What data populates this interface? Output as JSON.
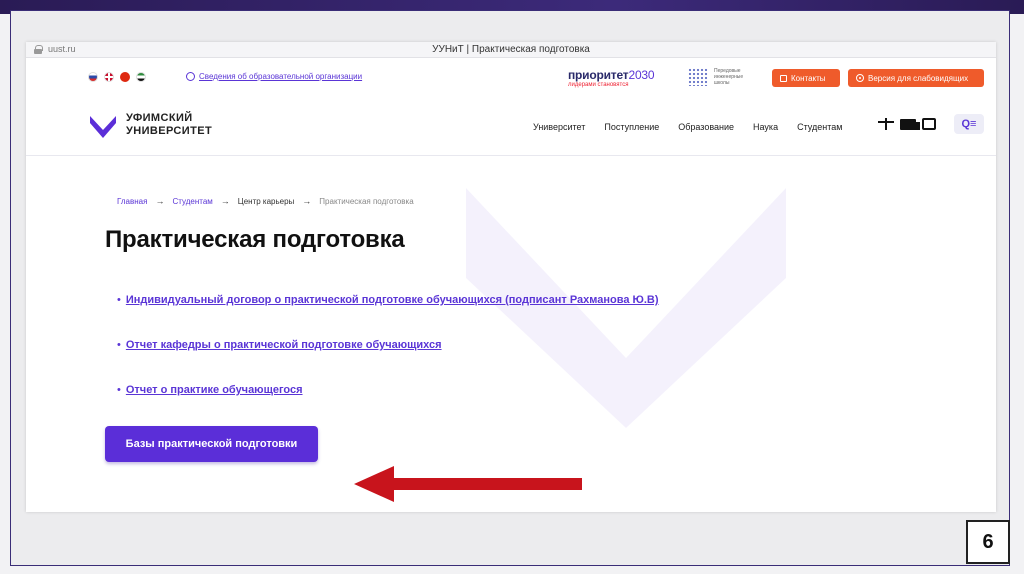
{
  "browser": {
    "url": "uust.ru",
    "tab_title": "УУНиТ | Практическая подготовка"
  },
  "topbar": {
    "languages": [
      "ru",
      "en",
      "cn",
      "ar"
    ],
    "info_link": "Сведения об образовательной организации",
    "priority_logo": "приоритет",
    "priority_year": "2030",
    "priority_tagline": "лидерами становятся",
    "schools_text": "Передовые инженерные школы",
    "contacts_button": "Контакты",
    "visually_impaired_button": "Версия для слабовидящих"
  },
  "header": {
    "logo_line1": "УФИМСКИЙ",
    "logo_line2": "УНИВЕРСИТЕТ",
    "nav": [
      "Университет",
      "Поступление",
      "Образование",
      "Наука",
      "Студентам"
    ],
    "search_icon": "Q≡"
  },
  "breadcrumb": {
    "items": [
      "Главная",
      "Студентам",
      "Центр карьеры",
      "Практическая подготовка"
    ]
  },
  "page": {
    "title": "Практическая подготовка",
    "links": [
      "Индивидуальный договор о практической подготовке обучающихся (подписант Рахманова Ю.В)",
      "Отчет кафедры о практической подготовке обучающихся",
      "Отчет о практике обучающегося"
    ],
    "primary_button": "Базы практической подготовки"
  },
  "slide": {
    "number": "6"
  },
  "colors": {
    "accent": "#5b2ed8",
    "orange": "#ef5b2b",
    "arrow": "#c8141c"
  }
}
